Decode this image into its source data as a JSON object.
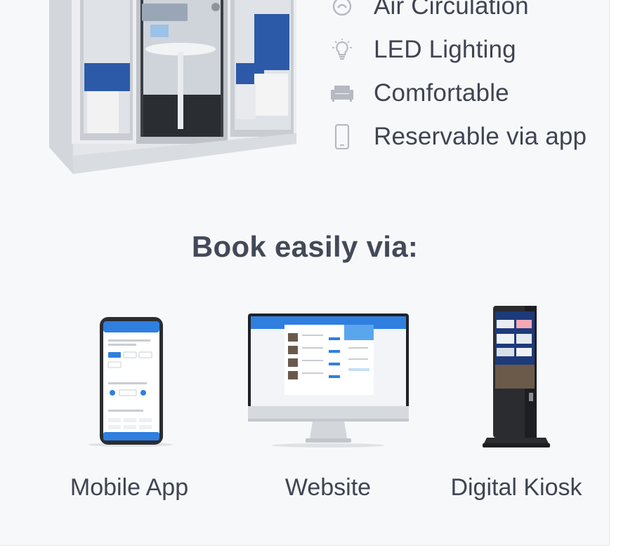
{
  "features": [
    {
      "icon": "air-circulation-icon",
      "label": "Air Circulation"
    },
    {
      "icon": "bulb-icon",
      "label": "LED Lighting"
    },
    {
      "icon": "sofa-icon",
      "label": "Comfortable"
    },
    {
      "icon": "phone-icon",
      "label": "Reservable via app"
    }
  ],
  "book_title": "Book easily via:",
  "options": [
    {
      "label": "Mobile App"
    },
    {
      "label": "Website"
    },
    {
      "label": "Digital Kiosk"
    }
  ],
  "colors": {
    "accent": "#2f7fe0",
    "seat_blue": "#2c5aa8",
    "text": "#3f4452",
    "icon_gray": "#b5b9c2"
  }
}
